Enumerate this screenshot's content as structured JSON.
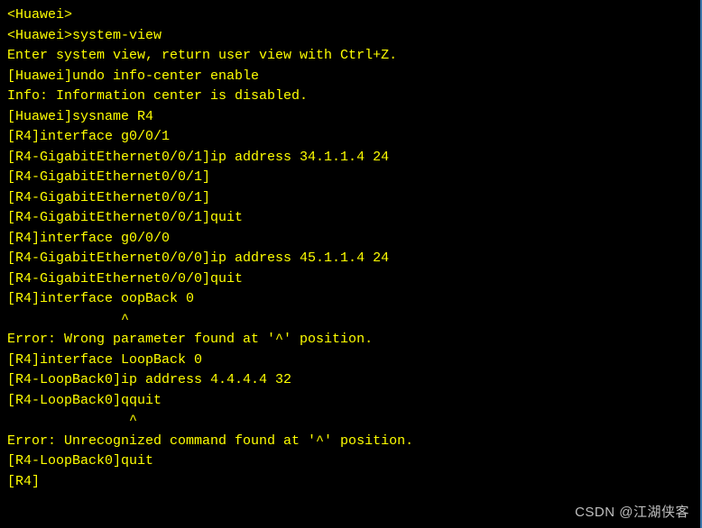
{
  "terminal": {
    "lines": [
      "<Huawei>",
      "<Huawei>system-view",
      "Enter system view, return user view with Ctrl+Z.",
      "[Huawei]undo info-center enable",
      "Info: Information center is disabled.",
      "[Huawei]sysname R4",
      "[R4]interface g0/0/1",
      "[R4-GigabitEthernet0/0/1]ip address 34.1.1.4 24",
      "[R4-GigabitEthernet0/0/1]",
      "[R4-GigabitEthernet0/0/1]",
      "[R4-GigabitEthernet0/0/1]quit",
      "[R4]interface g0/0/0",
      "[R4-GigabitEthernet0/0/0]ip address 45.1.1.4 24",
      "[R4-GigabitEthernet0/0/0]quit",
      "[R4]interface oopBack 0",
      "              ^",
      "Error: Wrong parameter found at '^' position.",
      "[R4]interface LoopBack 0",
      "[R4-LoopBack0]ip address 4.4.4.4 32",
      "[R4-LoopBack0]qquit",
      "               ^",
      "Error: Unrecognized command found at '^' position.",
      "[R4-LoopBack0]quit",
      "[R4]"
    ]
  },
  "watermark": "CSDN @江湖侠客"
}
